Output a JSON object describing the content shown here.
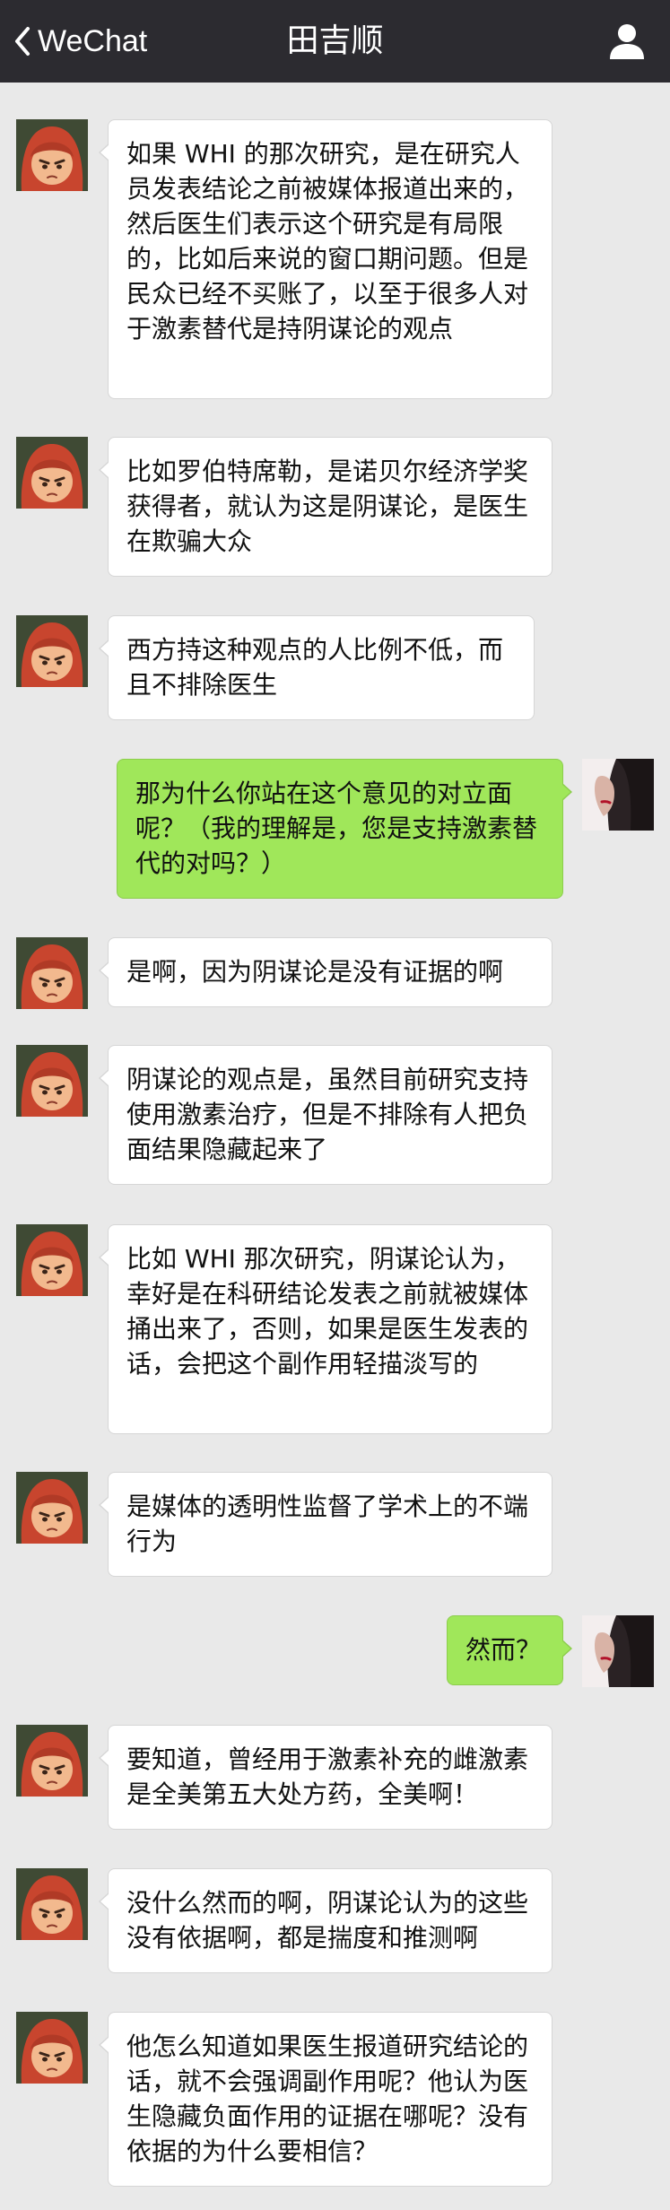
{
  "navbar": {
    "back_label": "WeChat",
    "title": "田吉顺",
    "back_icon": "chevron-left-icon",
    "profile_icon": "person-icon"
  },
  "messages": [
    {
      "side": "left",
      "text": "如果 WHI 的那次研究，是在研究人员发表结论之前被媒体报道出来的，然后医生们表示这个研究是有局限的，比如后来说的窗口期问题。但是民众已经不买账了，以至于很多人对于激素替代是持阴谋论的观点"
    },
    {
      "side": "left",
      "text": "比如罗伯特席勒，是诺贝尔经济学奖获得者，就认为这是阴谋论，是医生在欺骗大众"
    },
    {
      "side": "left",
      "text": "西方持这种观点的人比例不低，而且不排除医生"
    },
    {
      "side": "right",
      "text": "那为什么你站在这个意见的对立面呢？（我的理解是，您是支持激素替代的对吗？）"
    },
    {
      "side": "left",
      "text": "是啊，因为阴谋论是没有证据的啊"
    },
    {
      "side": "left",
      "text": "阴谋论的观点是，虽然目前研究支持使用激素治疗，但是不排除有人把负面结果隐藏起来了"
    },
    {
      "side": "left",
      "text": "比如 WHI 那次研究，阴谋论认为，幸好是在科研结论发表之前就被媒体捅出来了，否则，如果是医生发表的话，会把这个副作用轻描淡写的"
    },
    {
      "side": "left",
      "text": "是媒体的透明性监督了学术上的不端行为"
    },
    {
      "side": "right",
      "text": "然而？"
    },
    {
      "side": "left",
      "text": "要知道，曾经用于激素补充的雌激素是全美第五大处方药，全美啊！"
    },
    {
      "side": "left",
      "text": "没什么然而的啊，阴谋论认为的这些没有依据啊，都是揣度和推测啊"
    },
    {
      "side": "left",
      "text": "他怎么知道如果医生报道研究结论的话，就不会强调副作用呢？他认为医生隐藏负面作用的证据在哪呢？没有依据的为什么要相信？"
    }
  ],
  "colors": {
    "navbar_bg": "#2c2b30",
    "chat_bg": "#e9e9e9",
    "bubble_left": "#ffffff",
    "bubble_right": "#a0e75a"
  },
  "avatars": {
    "left": "red-hood-girl-avatar",
    "right": "woman-profile-avatar"
  }
}
